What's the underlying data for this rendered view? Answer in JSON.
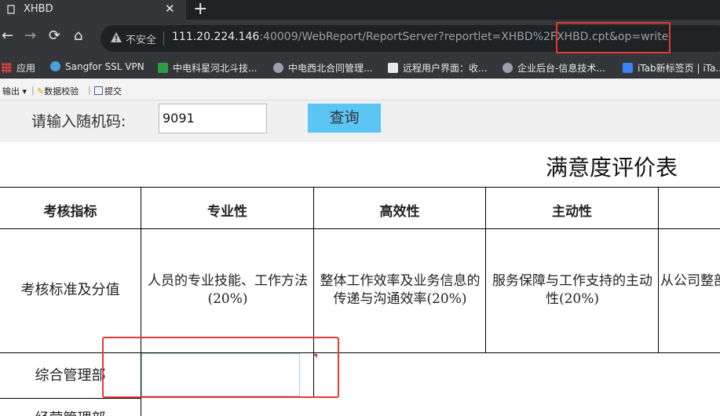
{
  "browser": {
    "tab": {
      "title": "XHBD",
      "close": "✕"
    },
    "new_tab": "+",
    "nav": {
      "back": "←",
      "forward": "→",
      "reload": "⟳",
      "home": "⌂"
    },
    "omnibox": {
      "insecure_label": "不安全",
      "url_host": "111.20.224.146",
      "url_rest": ":40009/WebReport/ReportServer?reportlet=XHBD%2FXHBD.cpt&op=write"
    },
    "bookmarks": [
      {
        "label": "应用",
        "icon": "apps-icon",
        "color": "#e8453c"
      },
      {
        "label": "Sangfor SSL VPN",
        "icon": "globe-icon",
        "color": "#4a9fd8"
      },
      {
        "label": "中电科星河北斗技...",
        "icon": "snowflake-icon",
        "color": "#2e9d4a"
      },
      {
        "label": "中电西北合同管理...",
        "icon": "globe-icon",
        "color": "#9aa0a6"
      },
      {
        "label": "远程用户界面：收...",
        "icon": "butterfly-icon",
        "color": "#e8eaed"
      },
      {
        "label": "企业后台-信息技术...",
        "icon": "globe-icon",
        "color": "#9aa0a6"
      },
      {
        "label": "iTab新标签页 | iTa...",
        "icon": "itab-icon",
        "color": "#3b82f6"
      }
    ]
  },
  "report_toolbar": {
    "export": "输出",
    "validate": "数据校验",
    "submit": "提交"
  },
  "query": {
    "label": "请输入随机码:",
    "value": "9091",
    "button": "查询"
  },
  "report": {
    "title": "满意度评价表",
    "headers": [
      "考核指标",
      "专业性",
      "高效性",
      "主动性"
    ],
    "criteria_label": "考核标准及分值",
    "criteria": [
      "人员的专业技能、工作方法(20%)",
      "整体工作效率及业务信息的传递与沟通效率(20%)",
      "服务保障与工作支持的主动性(20%)",
      "从公司整部 门才"
    ],
    "rows": [
      {
        "dept": "综合管理部"
      },
      {
        "dept": "经营管理部"
      }
    ]
  },
  "colors": {
    "accent_button": "#5bc6f4",
    "highlight": "#e53935",
    "chrome_dark": "#35363a"
  }
}
